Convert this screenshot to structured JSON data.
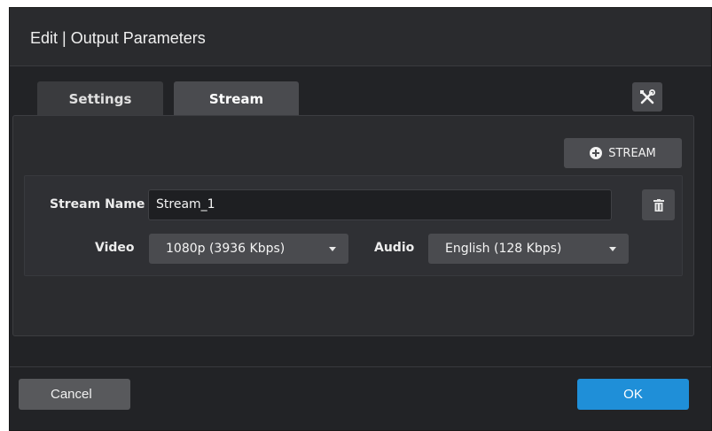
{
  "dialog": {
    "title": "Edit | Output Parameters"
  },
  "tabs": [
    {
      "label": "Settings",
      "active": false
    },
    {
      "label": "Stream",
      "active": true
    }
  ],
  "toolbar": {
    "tools_icon": "tools-icon"
  },
  "add_stream": {
    "icon": "plus-circle-icon",
    "label": "STREAM"
  },
  "stream": {
    "name_label": "Stream Name",
    "name_value": "Stream_1",
    "video_label": "Video",
    "video_value": "1080p (3936 Kbps)",
    "audio_label": "Audio",
    "audio_value": "English (128 Kbps)",
    "delete_icon": "trash-icon"
  },
  "footer": {
    "cancel_label": "Cancel",
    "ok_label": "OK"
  },
  "colors": {
    "background": "#222326",
    "panel": "#2b2c2f",
    "button": "#4a4b4f",
    "primary": "#1f8fd8"
  }
}
